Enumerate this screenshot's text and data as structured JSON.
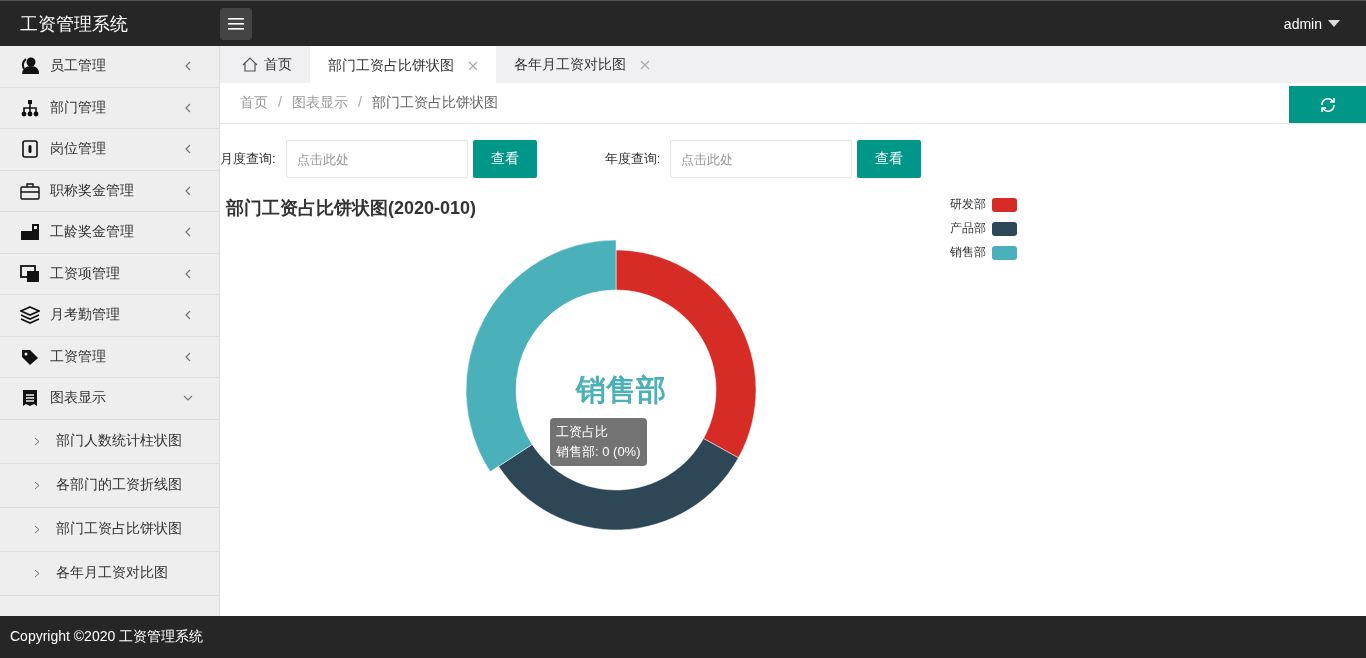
{
  "header": {
    "title": "工资管理系统",
    "user": "admin"
  },
  "sidebar": {
    "items": [
      {
        "label": "员工管理",
        "expanded": false
      },
      {
        "label": "部门管理",
        "expanded": false
      },
      {
        "label": "岗位管理",
        "expanded": false
      },
      {
        "label": "职称奖金管理",
        "expanded": false
      },
      {
        "label": "工龄奖金管理",
        "expanded": false
      },
      {
        "label": "工资项管理",
        "expanded": false
      },
      {
        "label": "月考勤管理",
        "expanded": false
      },
      {
        "label": "工资管理",
        "expanded": false
      },
      {
        "label": "图表显示",
        "expanded": true,
        "children": [
          {
            "label": "部门人数统计柱状图"
          },
          {
            "label": "各部门的工资折线图"
          },
          {
            "label": "部门工资占比饼状图"
          },
          {
            "label": "各年月工资对比图"
          }
        ]
      }
    ]
  },
  "tabs": [
    {
      "label": "首页",
      "kind": "home",
      "selected": false,
      "closable": false
    },
    {
      "label": "部门工资占比饼状图",
      "kind": "page",
      "selected": true,
      "closable": true
    },
    {
      "label": "各年月工资对比图",
      "kind": "page",
      "selected": false,
      "closable": true
    }
  ],
  "breadcrumb": {
    "separator": "/",
    "items": [
      "首页",
      "图表显示",
      "部门工资占比饼状图"
    ]
  },
  "filters": [
    {
      "label": "月度查询:",
      "placeholder": "点击此处",
      "button": "查看"
    },
    {
      "label": "年度查询:",
      "placeholder": "点击此处",
      "button": "查看"
    }
  ],
  "chart": {
    "title": "部门工资占比饼状图(2020-010)",
    "center_label": "销售部",
    "tooltip": {
      "title": "工资占比",
      "text": "销售部: 0 (0%)"
    },
    "legend": [
      {
        "name": "研发部",
        "color": "#d72b26"
      },
      {
        "name": "产品部",
        "color": "#2d4756"
      },
      {
        "name": "销售部",
        "color": "#4ab0ba"
      }
    ]
  },
  "footer": "Copyright ©2020 工资管理系统"
}
